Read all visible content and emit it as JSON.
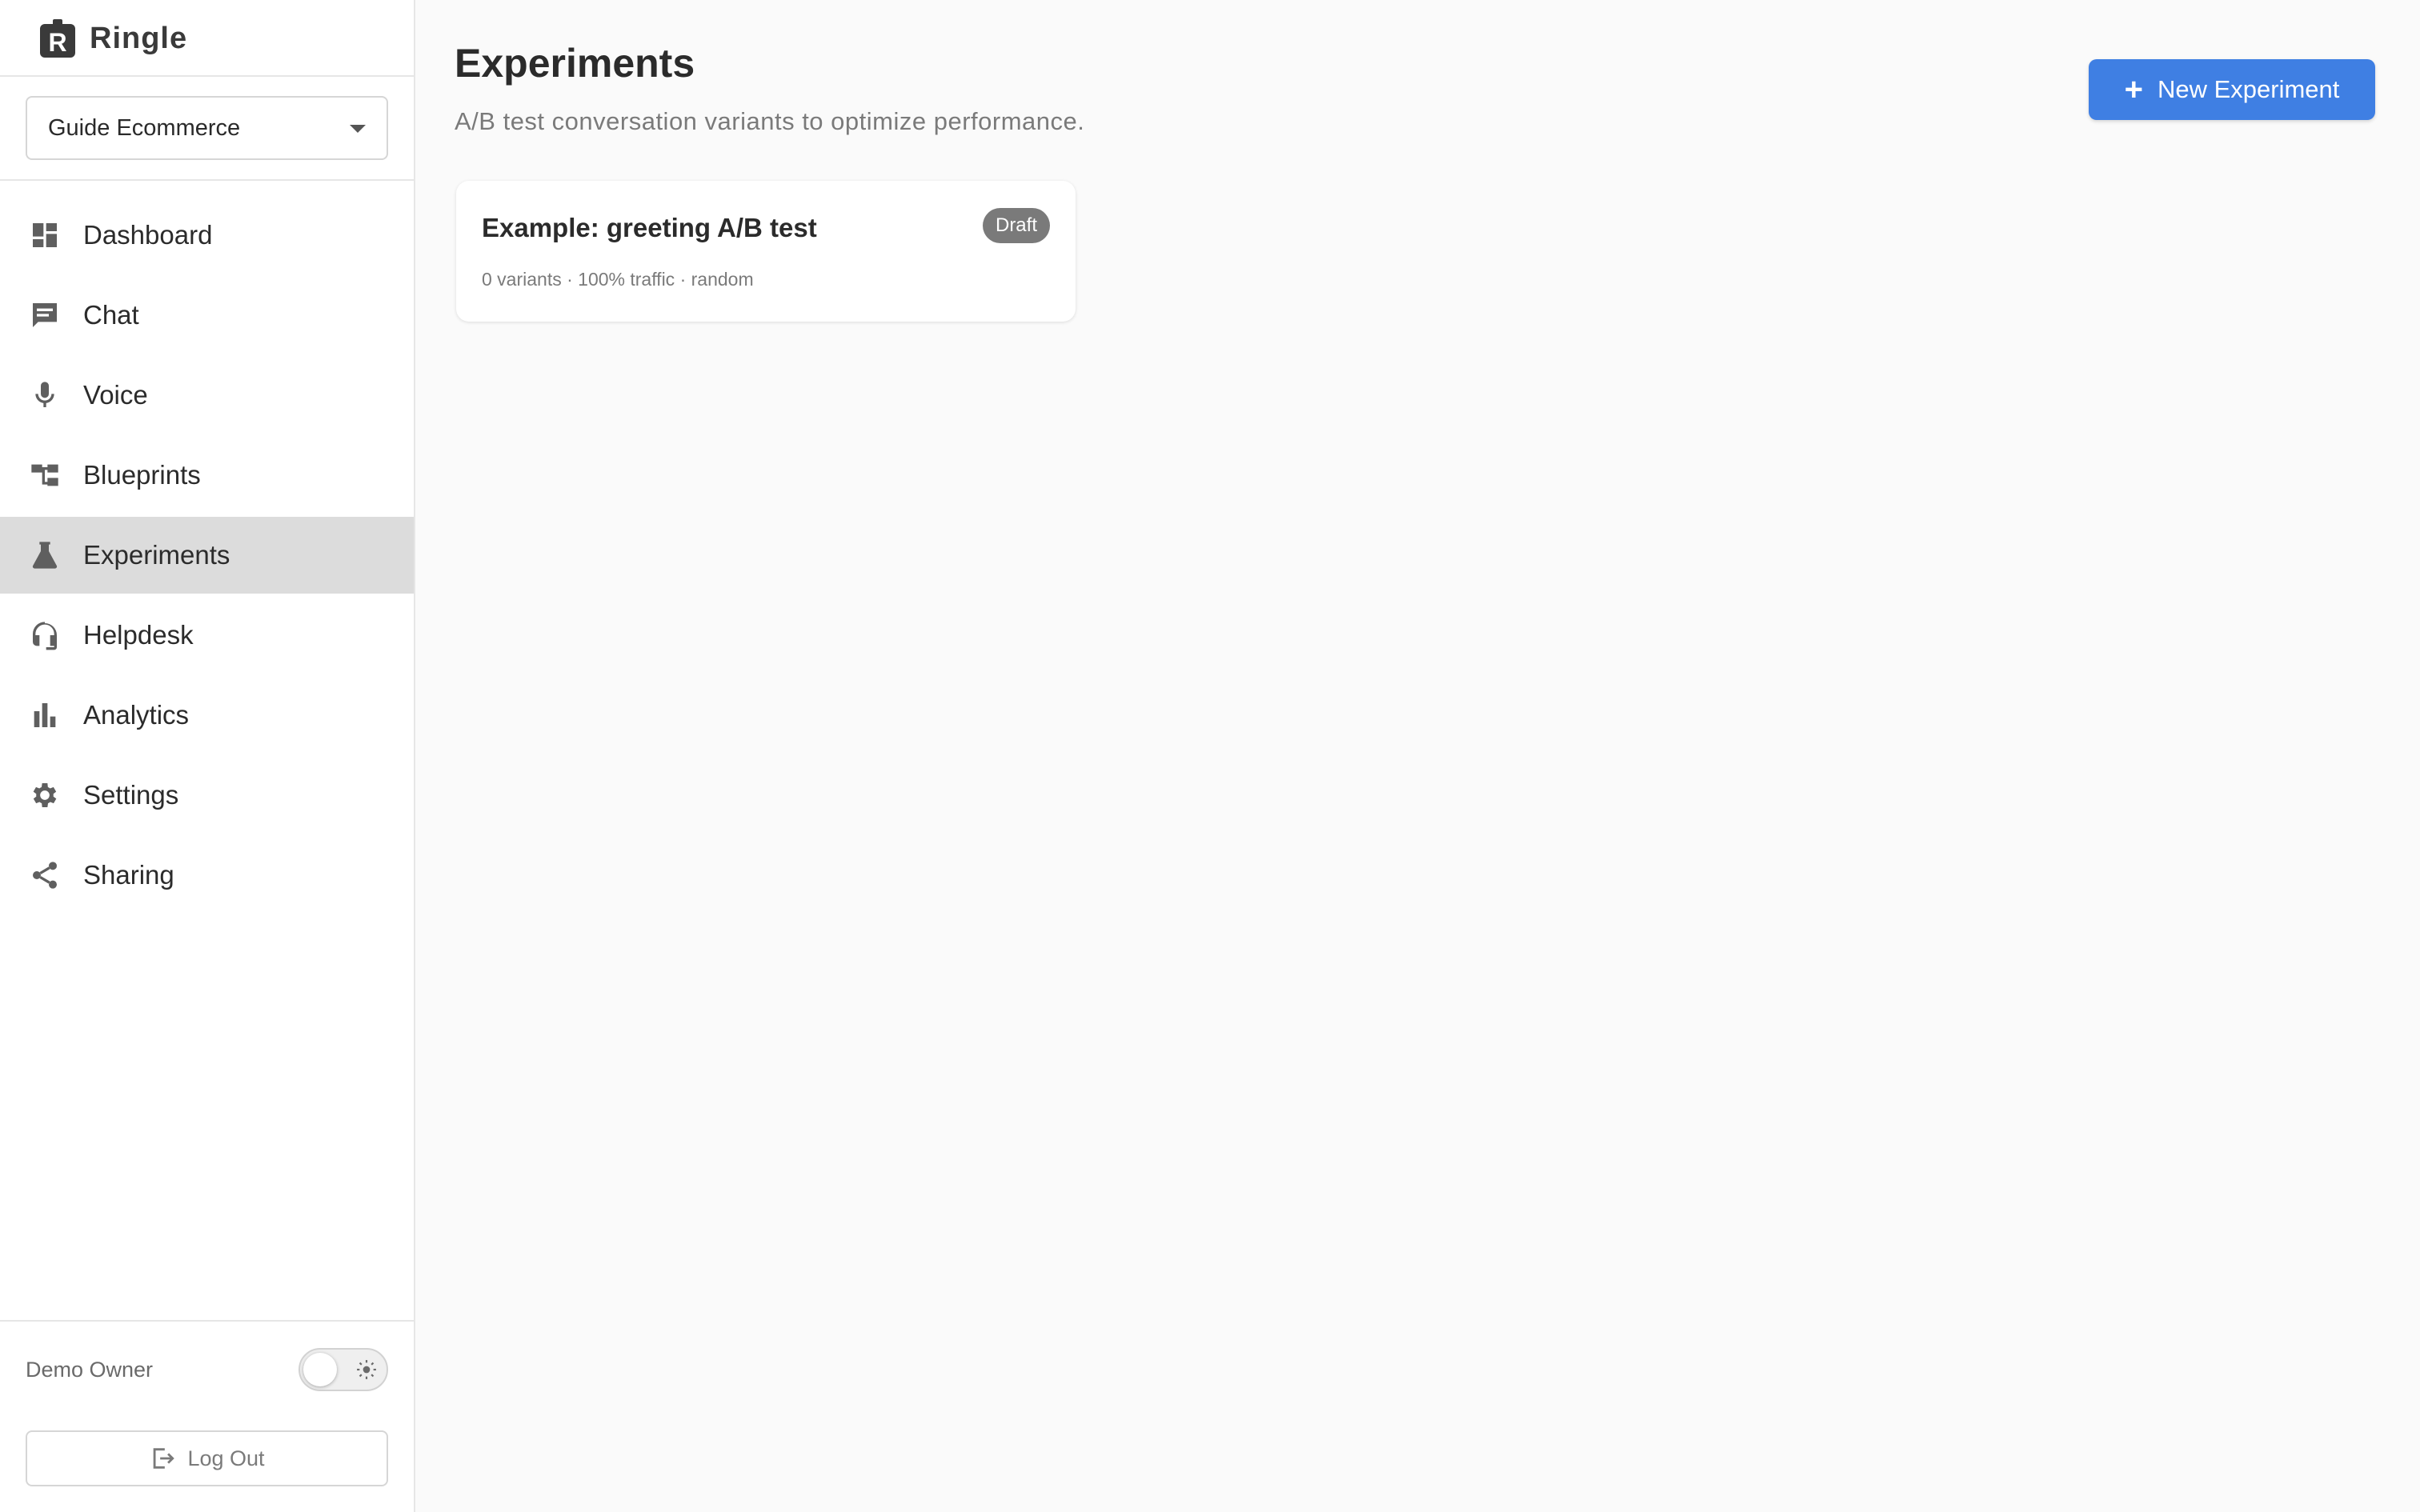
{
  "app": {
    "name": "Ringle"
  },
  "workspace": {
    "selected": "Guide Ecommerce"
  },
  "nav": {
    "items": [
      {
        "label": "Dashboard",
        "icon": "dashboard-icon"
      },
      {
        "label": "Chat",
        "icon": "chat-icon"
      },
      {
        "label": "Voice",
        "icon": "microphone-icon"
      },
      {
        "label": "Blueprints",
        "icon": "blueprints-icon"
      },
      {
        "label": "Experiments",
        "icon": "flask-icon",
        "active": true
      },
      {
        "label": "Helpdesk",
        "icon": "headset-icon"
      },
      {
        "label": "Analytics",
        "icon": "bar-chart-icon"
      },
      {
        "label": "Settings",
        "icon": "gear-icon"
      },
      {
        "label": "Sharing",
        "icon": "share-icon"
      }
    ]
  },
  "user": {
    "name": "Demo Owner",
    "theme_toggle": "light"
  },
  "logout": {
    "label": "Log Out"
  },
  "page": {
    "title": "Experiments",
    "subtitle": "A/B test conversation variants to optimize performance.",
    "new_button": "New Experiment",
    "new_button_icon": "+"
  },
  "experiments": [
    {
      "title": "Example: greeting A/B test",
      "status": "Draft",
      "meta": "0 variants · 100% traffic · random"
    }
  ],
  "colors": {
    "accent": "#3f7fe3",
    "active_nav": "#dcdcdc",
    "badge": "#7a7a7a"
  }
}
